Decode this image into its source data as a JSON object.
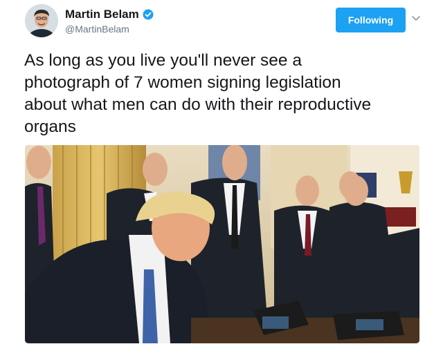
{
  "author": {
    "name": "Martin Belam",
    "handle": "@MartinBelam",
    "verified": true,
    "avatar_icon": "avatar-photo"
  },
  "follow_button": {
    "label": "Following",
    "color": "#1da1f2"
  },
  "menu": {
    "icon": "chevron-down-icon"
  },
  "tweet": {
    "lines": [
      "As long as you live you'll never see a",
      "photograph of 7 women signing legislation",
      "about what men can do with their reproductive",
      "organs"
    ]
  },
  "media": {
    "type": "photo",
    "icon": "attached-photo"
  },
  "colors": {
    "accent": "#1da1f2",
    "text": "#14171a",
    "muted": "#657786"
  }
}
